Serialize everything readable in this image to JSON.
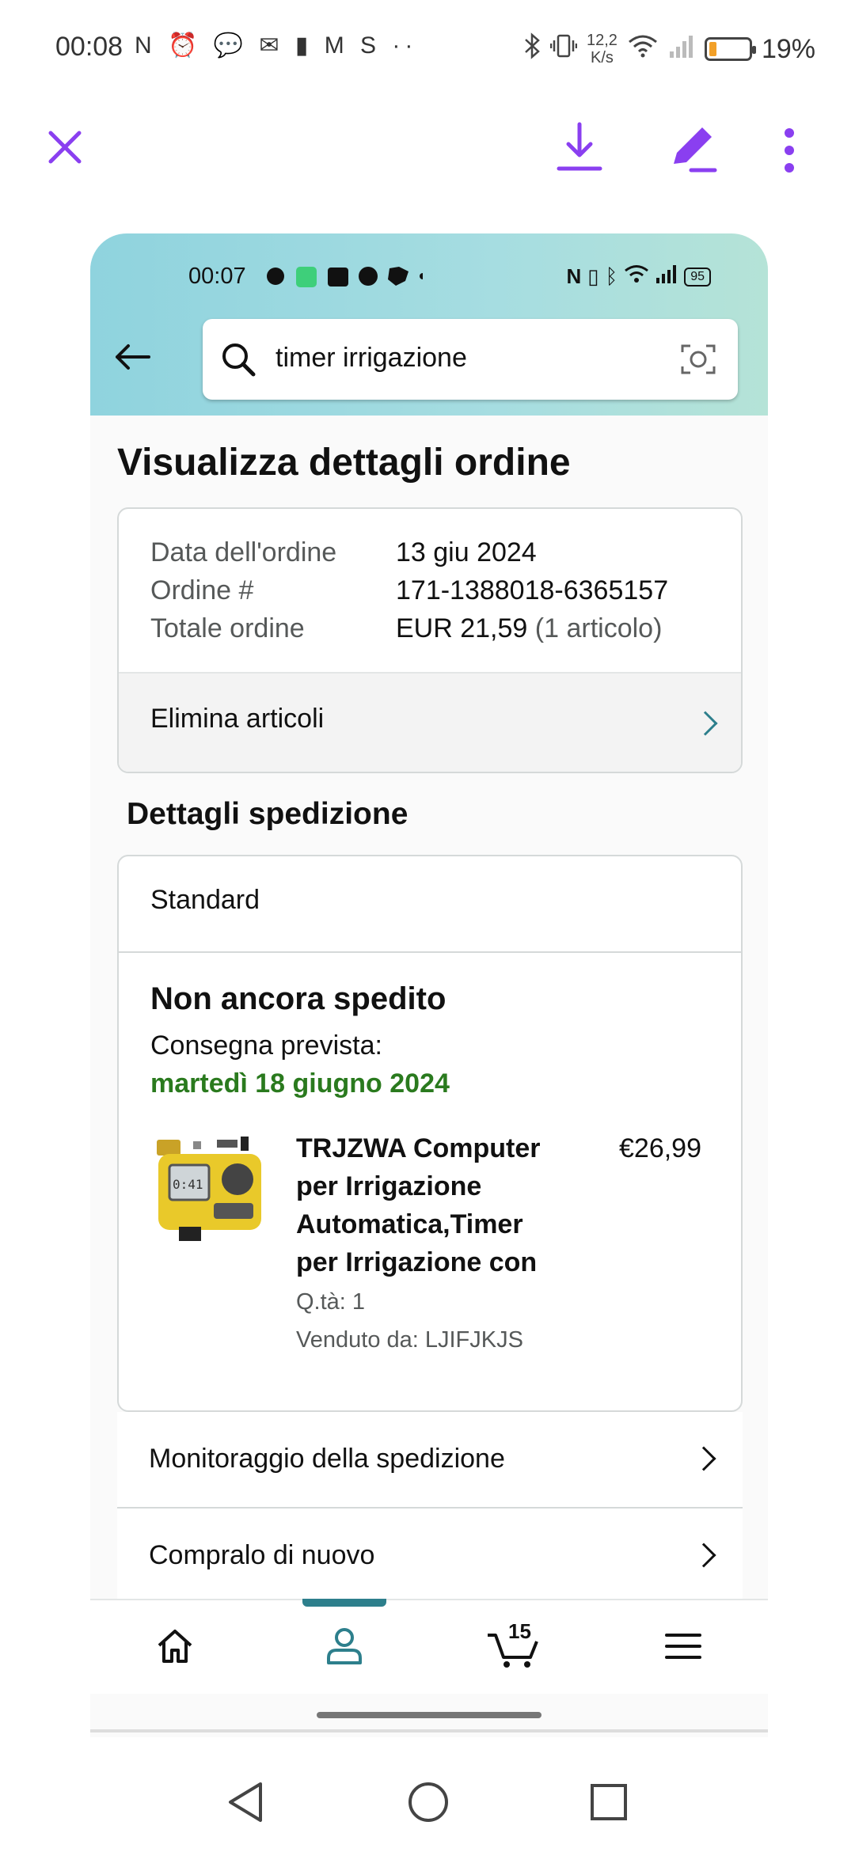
{
  "outer_status": {
    "time": "00:08",
    "notification_icons": "N ⏰ 💬 ✉ ▮ M S ··",
    "net_speed_value": "12,2",
    "net_speed_unit": "K/s",
    "battery_percent": "19%",
    "battery_level": 0.19
  },
  "viewer_toolbar": {
    "accent_color": "#8a3ff0",
    "icons": [
      "close-icon",
      "download-icon",
      "edit-icon",
      "more-vertical-icon"
    ]
  },
  "inner_status": {
    "time": "00:07",
    "battery": "95"
  },
  "search": {
    "query": "timer irrigazione"
  },
  "page": {
    "title": "Visualizza dettagli ordine"
  },
  "order": {
    "date_label": "Data dell'ordine",
    "date_value": "13 giu 2024",
    "number_label": "Ordine #",
    "number_value": "171-1388018-6365157",
    "total_label": "Totale ordine",
    "total_value": "EUR 21,59",
    "total_items": "(1 articolo)",
    "delete_items": "Elimina articoli"
  },
  "shipping": {
    "section_title": "Dettagli spedizione",
    "method": "Standard",
    "status": "Non ancora spedito",
    "delivery_label": "Consegna prevista:",
    "delivery_date": "martedì 18 giugno 2024",
    "delivery_color": "#2a7a1e"
  },
  "product": {
    "title_lines": [
      "TRJZWA Computer",
      "per Irrigazione",
      "Automatica,Timer",
      "per Irrigazione con"
    ],
    "price": "€26,99",
    "qty": "Q.tà: 1",
    "seller": "Venduto da: LJIFJKJS",
    "display_text": "0:41"
  },
  "actions": {
    "track": "Monitoraggio della spedizione",
    "buy_again": "Compralo di nuovo"
  },
  "bottom_nav": {
    "cart_count": "15",
    "active_color": "#2d7f8c"
  }
}
